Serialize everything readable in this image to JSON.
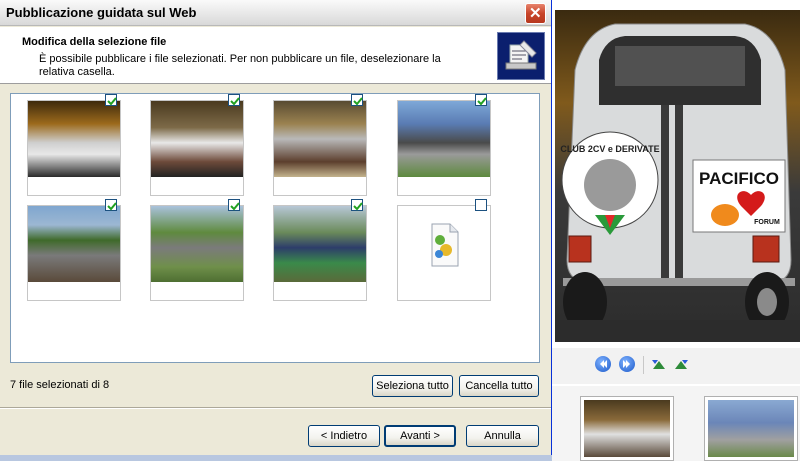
{
  "window": {
    "title": "Pubblicazione guidata sul Web",
    "close_icon": "close-icon"
  },
  "header": {
    "title": "Modifica della selezione file",
    "description": "È possibile pubblicare i file selezionati. Per non pubblicare un file, deselezionare la relativa casella.",
    "icon": "web-publishing-icon"
  },
  "files": [
    {
      "icon": "car-photo-thumbnail",
      "checked": true
    },
    {
      "icon": "car-photo-thumbnail",
      "checked": true
    },
    {
      "icon": "car-photo-thumbnail",
      "checked": true
    },
    {
      "icon": "race-track-photo-thumbnail",
      "checked": true
    },
    {
      "icon": "race-track-photo-thumbnail",
      "checked": true
    },
    {
      "icon": "race-track-photo-thumbnail",
      "checked": true
    },
    {
      "icon": "race-track-photo-thumbnail",
      "checked": true
    },
    {
      "icon": "generic-file-icon",
      "checked": false
    }
  ],
  "footer": {
    "status": "7 file selezionati di 8",
    "select_all": "Seleziona tutto",
    "clear_all": "Cancella tutto",
    "back": "< Indietro",
    "next": "Avanti >",
    "cancel": "Annulla"
  },
  "viewer": {
    "preview": {
      "sticker_top": "CLUB 2CV e DERIVATE",
      "sticker_brand": "PACIFICO",
      "sticker_sub": "FORUM"
    },
    "nav_icons": [
      "previous-image-icon",
      "next-image-icon",
      "rotate-left-icon",
      "rotate-right-icon"
    ]
  },
  "colors": {
    "window_border": "#0831d9",
    "button_border": "#003c74",
    "close_button": "#c8452a",
    "checkbox_mark": "#21a121"
  }
}
